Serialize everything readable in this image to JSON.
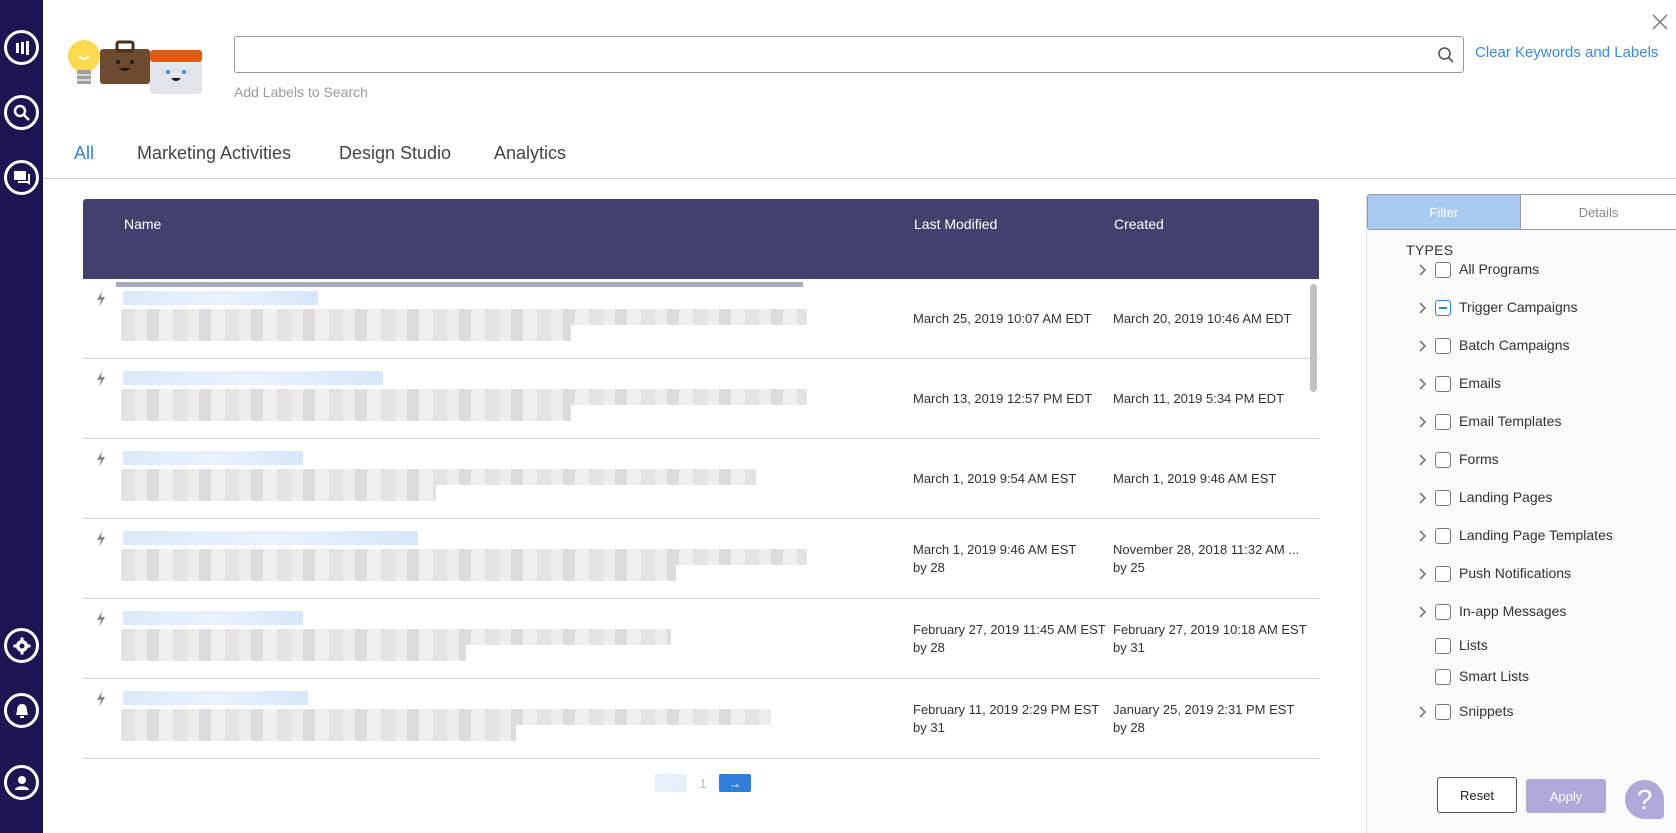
{
  "sidebar": {
    "items": [
      {
        "name": "marketo-logo-icon"
      },
      {
        "name": "search-icon"
      },
      {
        "name": "chat-icon"
      },
      {
        "name": "gear-icon"
      },
      {
        "name": "bell-icon"
      },
      {
        "name": "user-icon"
      }
    ],
    "bg_color": "#1b1552"
  },
  "search": {
    "value": "",
    "placeholder": "",
    "labels_hint": "Add Labels to Search",
    "clear_label": "Clear Keywords and Labels"
  },
  "tabs": [
    {
      "label": "All",
      "active": true
    },
    {
      "label": "Marketing Activities",
      "active": false
    },
    {
      "label": "Design Studio",
      "active": false
    },
    {
      "label": "Analytics",
      "active": false
    }
  ],
  "table": {
    "columns": {
      "name": "Name",
      "last_modified": "Last Modified",
      "created": "Created"
    },
    "rows": [
      {
        "icon": "bolt-icon",
        "last_modified": "March 25, 2019 10:07 AM EDT",
        "last_modified_by": "",
        "created": "March 20, 2019 10:46 AM EDT",
        "created_by": ""
      },
      {
        "icon": "bolt-icon",
        "last_modified": "March 13, 2019 12:57 PM EDT",
        "last_modified_by": "",
        "created": "March 11, 2019 5:34 PM EDT",
        "created_by": ""
      },
      {
        "icon": "bolt-icon",
        "last_modified": "March 1, 2019 9:54 AM EST",
        "last_modified_by": "",
        "created": "March 1, 2019 9:46 AM EST",
        "created_by": ""
      },
      {
        "icon": "bolt-icon",
        "last_modified": "March 1, 2019 9:46 AM EST",
        "last_modified_by": "by 28",
        "created": "November 28, 2018 11:32 AM ...",
        "created_by": "by 25"
      },
      {
        "icon": "bolt-icon",
        "last_modified": "February 27, 2019 11:45 AM EST",
        "last_modified_by": "by 28",
        "created": "February 27, 2019 10:18 AM EST",
        "created_by": "by 31"
      },
      {
        "icon": "bolt-icon",
        "last_modified": "February 11, 2019 2:29 PM EST",
        "last_modified_by": "by 31",
        "created": "January 25, 2019 2:31 PM EST",
        "created_by": "by 28"
      }
    ],
    "header_color": "#42406d"
  },
  "pagination": {
    "prev": "←",
    "page": "1",
    "next": "→"
  },
  "panel": {
    "tabs": {
      "filter": "Filter",
      "details": "Details"
    },
    "section_title": "TYPES",
    "types": [
      {
        "label": "All Programs",
        "expandable": true,
        "state": "unchecked"
      },
      {
        "label": "Trigger Campaigns",
        "expandable": true,
        "state": "partial"
      },
      {
        "label": "Batch Campaigns",
        "expandable": true,
        "state": "unchecked"
      },
      {
        "label": "Emails",
        "expandable": true,
        "state": "unchecked"
      },
      {
        "label": "Email Templates",
        "expandable": true,
        "state": "unchecked"
      },
      {
        "label": "Forms",
        "expandable": true,
        "state": "unchecked"
      },
      {
        "label": "Landing Pages",
        "expandable": true,
        "state": "unchecked"
      },
      {
        "label": "Landing Page Templates",
        "expandable": true,
        "state": "unchecked"
      },
      {
        "label": "Push Notifications",
        "expandable": true,
        "state": "unchecked"
      },
      {
        "label": "In-app Messages",
        "expandable": true,
        "state": "unchecked"
      },
      {
        "label": "Lists",
        "expandable": false,
        "state": "unchecked"
      },
      {
        "label": "Smart Lists",
        "expandable": false,
        "state": "unchecked"
      },
      {
        "label": "Snippets",
        "expandable": true,
        "state": "unchecked"
      }
    ],
    "reset_label": "Reset",
    "apply_label": "Apply"
  },
  "help": {
    "label": "?"
  },
  "colors": {
    "accent": "#2f80d8",
    "apply": "#b0a8d8",
    "filter_tab": "#a9caf0"
  }
}
